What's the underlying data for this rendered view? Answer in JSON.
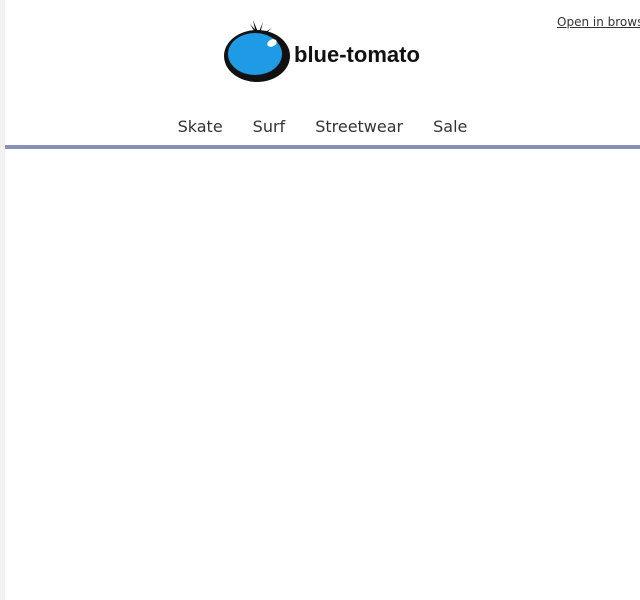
{
  "header": {
    "open_in_browser": "Open in browser",
    "logo_text": "blue-tomato"
  },
  "nav": {
    "items": [
      {
        "label": "Skate"
      },
      {
        "label": "Surf"
      },
      {
        "label": "Streetwear"
      },
      {
        "label": "Sale"
      }
    ]
  },
  "colors": {
    "brand_blue": "#1e9be4",
    "nav_rule": "#8891b8",
    "text": "#333333"
  },
  "icons": {
    "logo": "tomato-logo-icon"
  }
}
